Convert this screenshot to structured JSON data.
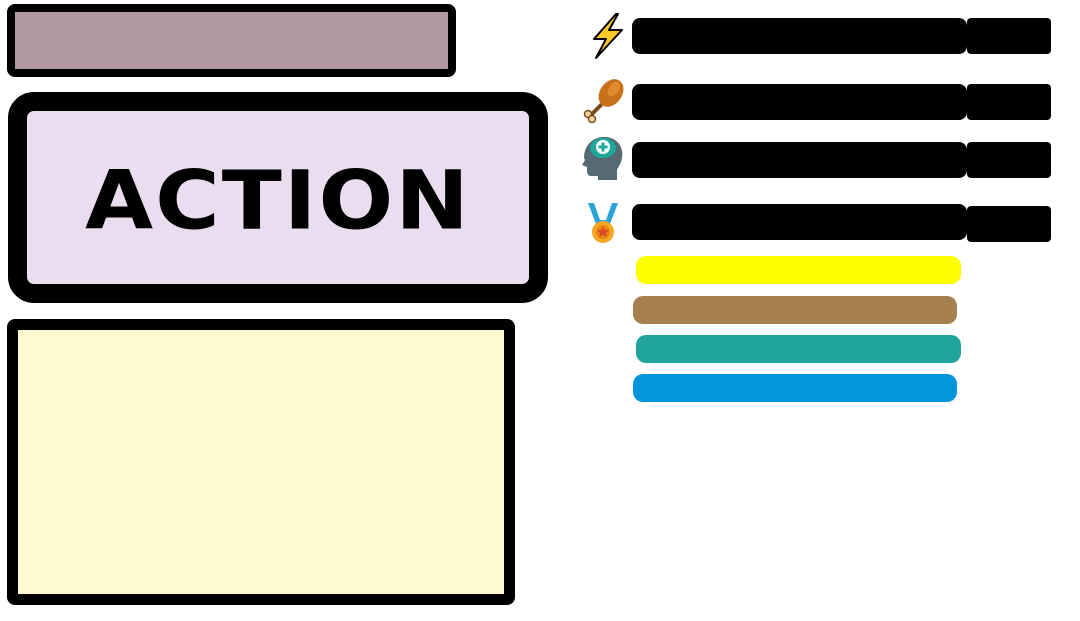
{
  "title_box": {
    "text": ""
  },
  "action_button": {
    "label": "ACTION"
  },
  "info_panel": {
    "text": ""
  },
  "stats": [
    {
      "id": "energy",
      "icon": "lightning-icon",
      "value_text": "",
      "bar_color": "#ffff00",
      "level": 1.0
    },
    {
      "id": "hunger",
      "icon": "chicken-leg-icon",
      "value_text": "",
      "bar_color": "#a67f4f",
      "level": 0.99
    },
    {
      "id": "mind",
      "icon": "brain-health-icon",
      "value_text": "",
      "bar_color": "#20a39a",
      "level": 1.0
    },
    {
      "id": "reputation",
      "icon": "medal-icon",
      "value_text": "",
      "bar_color": "#0096d9",
      "level": 0.99
    }
  ]
}
